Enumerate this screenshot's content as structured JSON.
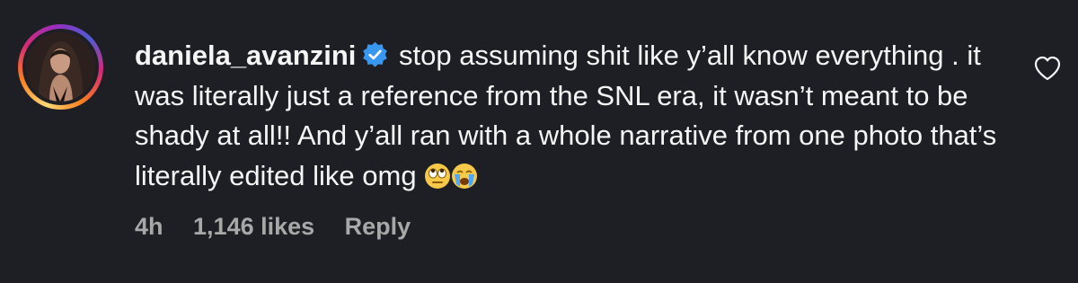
{
  "comment": {
    "username": "daniela_avanzini",
    "text_line1": "stop assuming shit like y’all know",
    "text_rest": "everything . it was literally just a reference from the SNL era, it wasn’t meant to be shady at all!! And y’all ran with a whole narrative from one photo that’s literally edited like omg",
    "emojis": [
      "eye-roll-emoji",
      "crying-emoji"
    ],
    "time": "4h",
    "likes": "1,146 likes",
    "reply_label": "Reply",
    "verified_icon": "verified-badge-icon",
    "like_icon": "heart-icon"
  },
  "colors": {
    "background": "#1e1f24",
    "text": "#f5f5f5",
    "meta": "#a8a8a8",
    "verified": "#3897f0"
  }
}
